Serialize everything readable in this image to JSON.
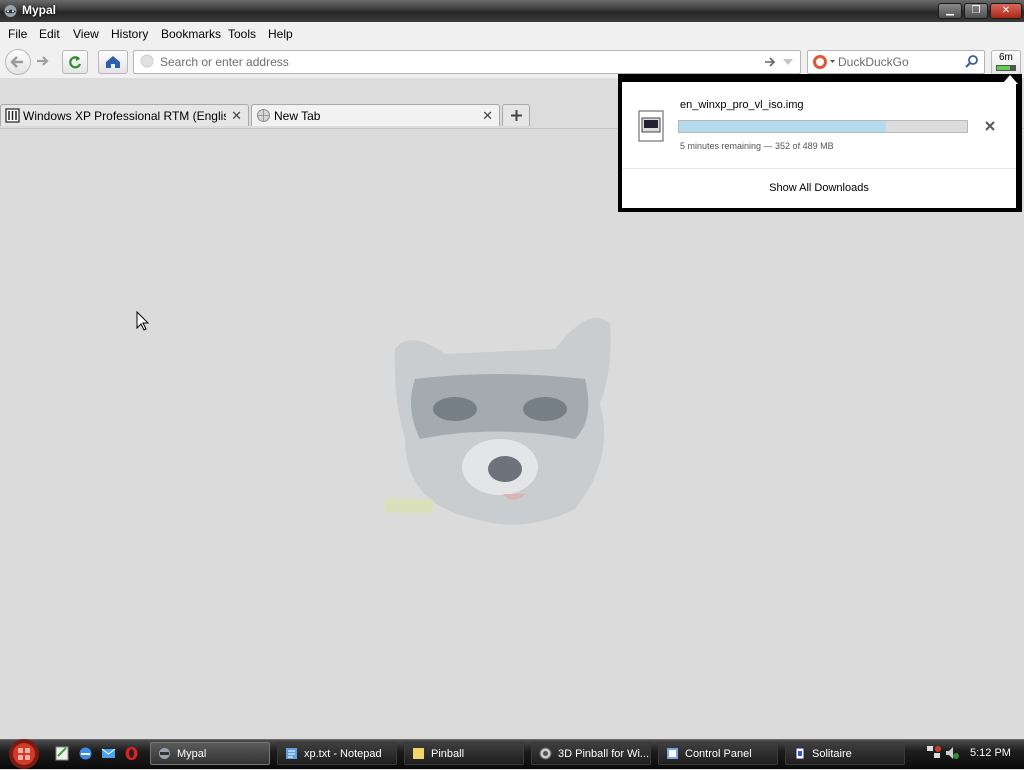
{
  "window": {
    "title": "Mypal"
  },
  "menu": [
    "File",
    "Edit",
    "View",
    "History",
    "Bookmarks",
    "Tools",
    "Help"
  ],
  "urlbar": {
    "placeholder": "Search or enter address"
  },
  "search": {
    "engine": "DuckDuckGo"
  },
  "downloads_button": {
    "label": "6m"
  },
  "tabs": [
    {
      "label": "Windows XP Professional RTM (English ...",
      "active": false
    },
    {
      "label": "New Tab",
      "active": true
    }
  ],
  "download": {
    "filename": "en_winxp_pro_vl_iso.img",
    "status": "5 minutes remaining — 352 of 489 MB",
    "progress_fraction": 0.72,
    "show_all": "Show All Downloads"
  },
  "taskbar": {
    "tasks": [
      {
        "label": "Mypal",
        "active": true
      },
      {
        "label": "xp.txt - Notepad",
        "active": false
      },
      {
        "label": "Pinball",
        "active": false
      },
      {
        "label": "3D Pinball for Wi...",
        "active": false
      },
      {
        "label": "Control Panel",
        "active": false
      },
      {
        "label": "Solitaire",
        "active": false
      }
    ],
    "clock": "5:12 PM"
  },
  "colors": {
    "progress_fill": "#b4dcee",
    "content_bg": "#dbdbdb"
  }
}
